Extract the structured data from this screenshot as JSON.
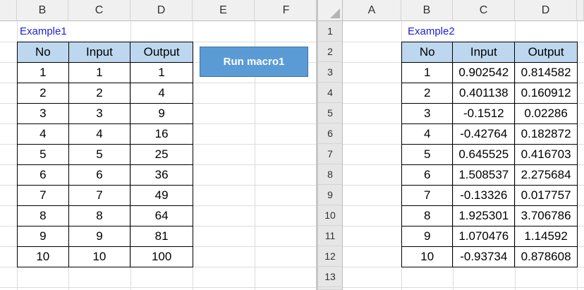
{
  "left": {
    "col_headers": [
      "B",
      "C",
      "D",
      "E",
      "F"
    ],
    "title": "Example1",
    "headers": [
      "No",
      "Input",
      "Output"
    ],
    "rows": [
      [
        "1",
        "1",
        "1"
      ],
      [
        "2",
        "2",
        "4"
      ],
      [
        "3",
        "3",
        "9"
      ],
      [
        "4",
        "4",
        "16"
      ],
      [
        "5",
        "5",
        "25"
      ],
      [
        "6",
        "6",
        "36"
      ],
      [
        "7",
        "7",
        "49"
      ],
      [
        "8",
        "8",
        "64"
      ],
      [
        "9",
        "9",
        "81"
      ],
      [
        "10",
        "10",
        "100"
      ]
    ],
    "button_label": "Run macro1"
  },
  "right": {
    "col_headers": [
      "A",
      "B",
      "C",
      "D"
    ],
    "row_headers": [
      "1",
      "2",
      "3",
      "4",
      "5",
      "6",
      "7",
      "8",
      "9",
      "10",
      "11",
      "12",
      "13"
    ],
    "title": "Example2",
    "headers": [
      "No",
      "Input",
      "Output"
    ],
    "rows": [
      [
        "1",
        "0.902542",
        "0.814582"
      ],
      [
        "2",
        "0.401138",
        "0.160912"
      ],
      [
        "3",
        "-0.1512",
        "0.02286"
      ],
      [
        "4",
        "-0.42764",
        "0.182872"
      ],
      [
        "5",
        "0.645525",
        "0.416703"
      ],
      [
        "6",
        "1.508537",
        "2.275684"
      ],
      [
        "7",
        "-0.13326",
        "0.017757"
      ],
      [
        "8",
        "1.925301",
        "3.706786"
      ],
      [
        "9",
        "1.070476",
        "1.14592"
      ],
      [
        "10",
        "-0.93734",
        "0.878608"
      ]
    ]
  }
}
